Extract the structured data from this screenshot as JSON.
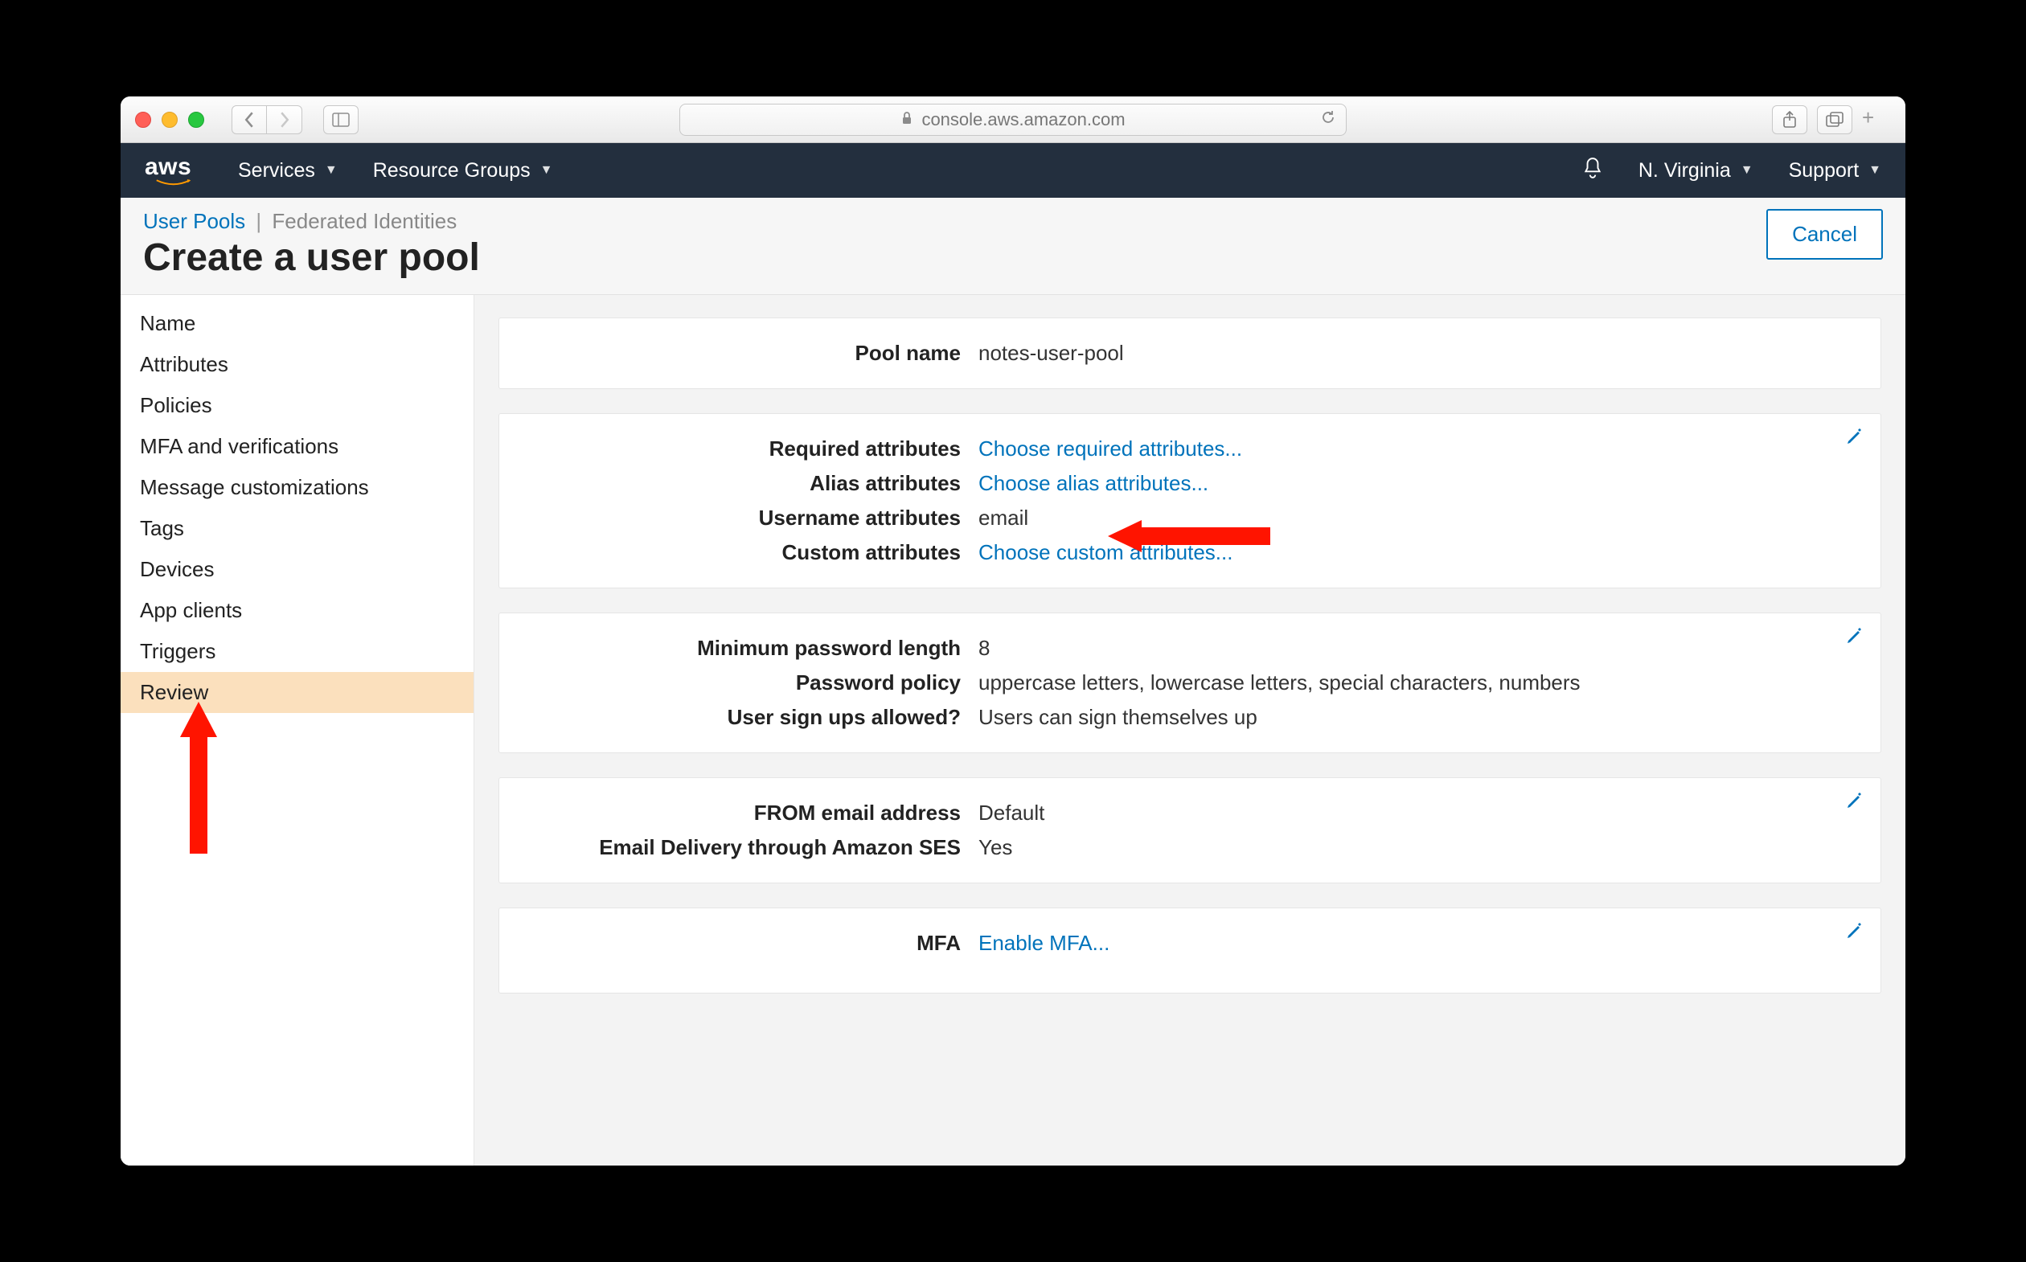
{
  "browser": {
    "url_host": "console.aws.amazon.com"
  },
  "awsnav": {
    "services": "Services",
    "resource_groups": "Resource Groups",
    "region": "N. Virginia",
    "support": "Support"
  },
  "breadcrumb": {
    "user_pools": "User Pools",
    "federated": "Federated Identities"
  },
  "page_title": "Create a user pool",
  "cancel": "Cancel",
  "sidebar": [
    {
      "label": "Name",
      "active": false
    },
    {
      "label": "Attributes",
      "active": false
    },
    {
      "label": "Policies",
      "active": false
    },
    {
      "label": "MFA and verifications",
      "active": false
    },
    {
      "label": "Message customizations",
      "active": false
    },
    {
      "label": "Tags",
      "active": false
    },
    {
      "label": "Devices",
      "active": false
    },
    {
      "label": "App clients",
      "active": false
    },
    {
      "label": "Triggers",
      "active": false
    },
    {
      "label": "Review",
      "active": true
    }
  ],
  "cards": {
    "name": {
      "pool_name_label": "Pool name",
      "pool_name_value": "notes-user-pool"
    },
    "attributes": {
      "required_label": "Required attributes",
      "required_value": "Choose required attributes...",
      "alias_label": "Alias attributes",
      "alias_value": "Choose alias attributes...",
      "username_label": "Username attributes",
      "username_value": "email",
      "custom_label": "Custom attributes",
      "custom_value": "Choose custom attributes..."
    },
    "policies": {
      "minlen_label": "Minimum password length",
      "minlen_value": "8",
      "policy_label": "Password policy",
      "policy_value": "uppercase letters, lowercase letters, special characters, numbers",
      "signup_label": "User sign ups allowed?",
      "signup_value": "Users can sign themselves up"
    },
    "email": {
      "from_label": "FROM email address",
      "from_value": "Default",
      "ses_label": "Email Delivery through Amazon SES",
      "ses_value": "Yes"
    },
    "mfa": {
      "mfa_label": "MFA",
      "mfa_value": "Enable MFA..."
    }
  }
}
